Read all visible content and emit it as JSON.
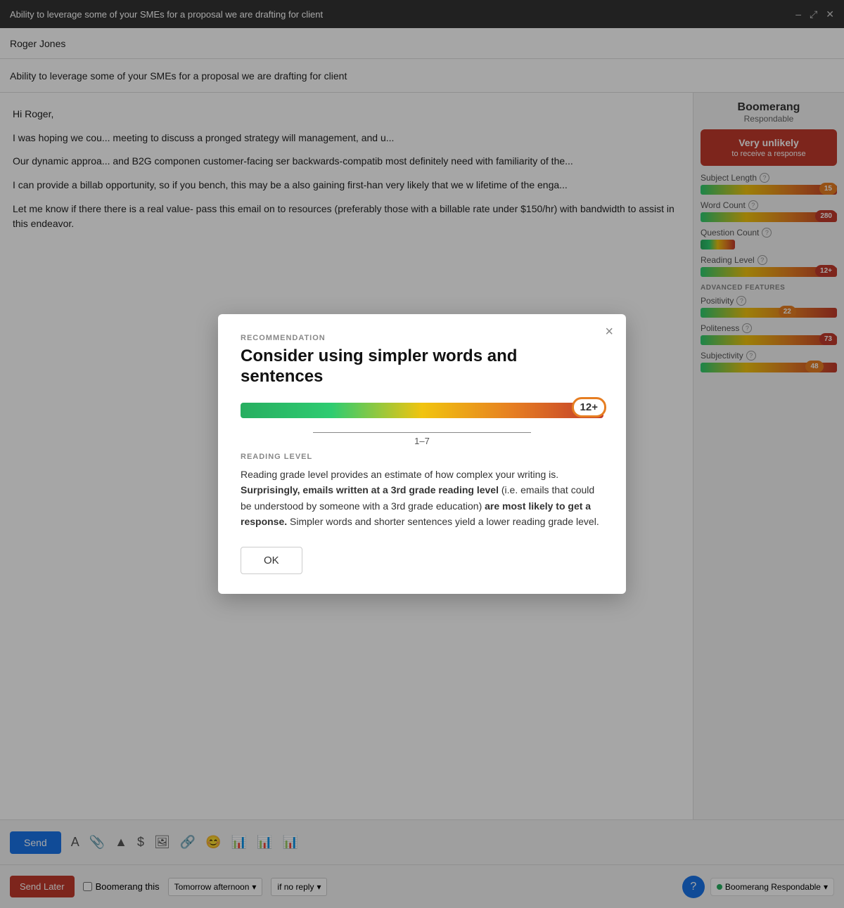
{
  "titleBar": {
    "title": "Ability to leverage some of your SMEs for a proposal we are drafting for client",
    "minimizeIcon": "–",
    "maximizeIcon": "⤢",
    "closeIcon": "✕"
  },
  "fromLine": {
    "label": "Roger Jones"
  },
  "subjectLine": {
    "text": "Ability to leverage some of your SMEs for a proposal we are drafting for client"
  },
  "emailBody": {
    "greeting": "Hi Roger,",
    "paragraph1": "I was hoping we cou... meeting to discuss a pronged strategy will management, and u...",
    "paragraph2": "Our dynamic approa... and B2G componen customer-facing ser backwards-compatib most definitely need with familiarity of the...",
    "paragraph3": "I can provide a billab opportunity, so if you bench, this may be a also gaining first-han very likely that we w lifetime of the enga...",
    "paragraph4": "Let me know if there there is a real value- pass this email on to resources (preferably those with a billable rate under $150/hr) with bandwidth to assist in this endeavor."
  },
  "sidebar": {
    "title": "Boomerang",
    "subtitle": "Respondable",
    "responseBadge": {
      "mainText": "Very unlikely",
      "subText": "to receive a response"
    },
    "metrics": [
      {
        "label": "ubject Length",
        "helpIcon": "?",
        "value": "15",
        "valueColor": "#e67e22",
        "barPosition": "right"
      },
      {
        "label": "Vord Count",
        "helpIcon": "?",
        "value": "280",
        "valueColor": "#c0392b",
        "barPosition": "right"
      },
      {
        "label": "uestion Count",
        "helpIcon": "?",
        "value": "",
        "barPosition": "right"
      },
      {
        "label": "eading Level",
        "helpIcon": "?",
        "value": "12+",
        "valueColor": "#c0392b",
        "barPosition": "right"
      }
    ],
    "advancedTitle": "VANCED FEATURES",
    "advancedMetrics": [
      {
        "label": "ositivity",
        "helpIcon": "?",
        "value": "22",
        "valueColor": "#e67e22"
      },
      {
        "label": "Politeness",
        "helpIcon": "?",
        "value": "73",
        "valueColor": "#27ae60"
      },
      {
        "label": "Subjectivity",
        "helpIcon": "?",
        "value": "48",
        "valueColor": "#e67e22"
      }
    ]
  },
  "toolbar": {
    "sendLabel": "Send",
    "icons": [
      "A",
      "📎",
      "▲",
      "$",
      "🖼",
      "🔗",
      "😊",
      "📊",
      "📊",
      "📊"
    ]
  },
  "bottomBar": {
    "sendLaterLabel": "Send Later",
    "boomerangCheck": "Boomerang this",
    "scheduleOption": "Tomorrow afternoon",
    "replyOption": "if no reply",
    "boomerangRespondable": "Boomerang Respondable"
  },
  "modal": {
    "sectionLabel": "RECOMMENDATION",
    "title": "Consider using simpler words and sentences",
    "readingBadge": "12+",
    "scaleLabel": "1–7",
    "readingLevelLabel": "READING LEVEL",
    "description": "Reading grade level provides an estimate of how complex your writing is.",
    "boldPart1": "Surprisingly, emails written at a 3rd grade reading level",
    "midPart": " (i.e. emails that could be understood by someone with a 3rd grade education) ",
    "boldPart2": "are most likely to get a response.",
    "endPart": " Simpler words and shorter sentences yield a lower reading grade level.",
    "okLabel": "OK"
  }
}
